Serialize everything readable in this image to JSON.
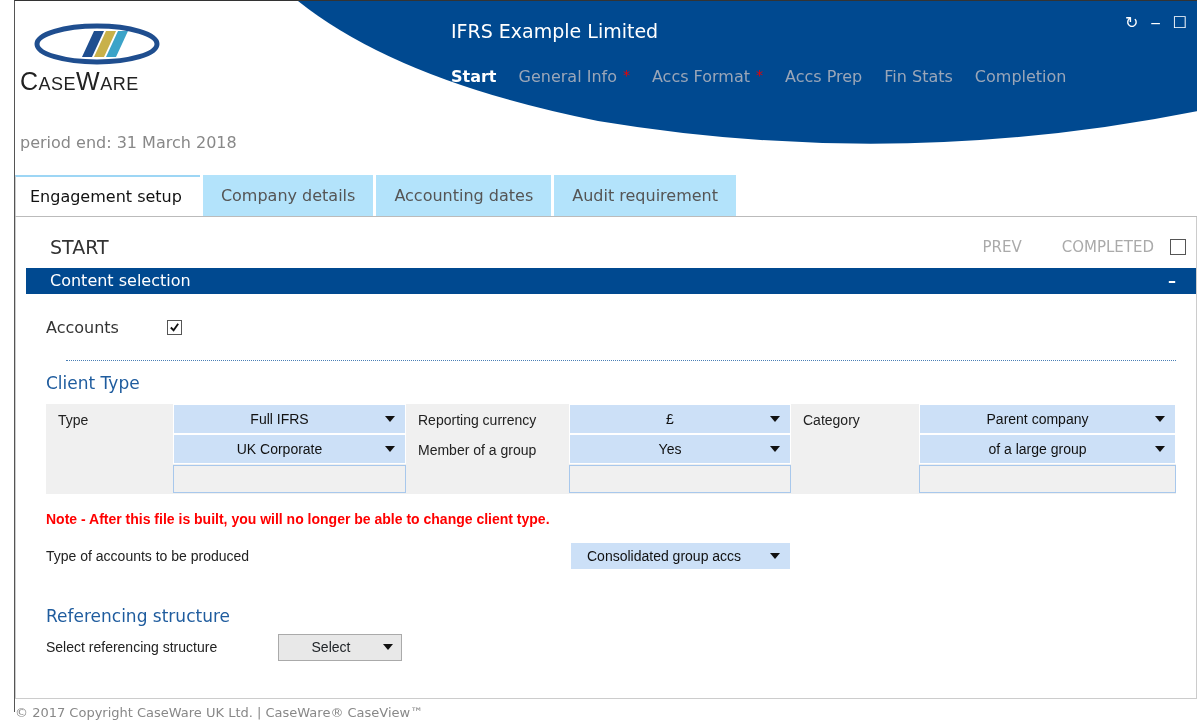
{
  "logo": {
    "wordmark": "CaseWare"
  },
  "header": {
    "title": "IFRS Example Limited"
  },
  "window_controls": [
    "↻",
    "‒",
    "☐"
  ],
  "nav": [
    {
      "label": "Start",
      "selected": true,
      "required": false
    },
    {
      "label": "General Info",
      "selected": false,
      "required": true
    },
    {
      "label": "Accs Format",
      "selected": false,
      "required": true
    },
    {
      "label": "Accs Prep",
      "selected": false,
      "required": false
    },
    {
      "label": "Fin Stats",
      "selected": false,
      "required": false
    },
    {
      "label": "Completion",
      "selected": false,
      "required": false
    }
  ],
  "required_mark": "*",
  "period_end": "period end: 31 March 2018",
  "tabs": [
    {
      "label": "Engagement setup",
      "selected": true
    },
    {
      "label": "Company details",
      "selected": false
    },
    {
      "label": "Accounting dates",
      "selected": false
    },
    {
      "label": "Audit requirement",
      "selected": false
    }
  ],
  "page_title": "START",
  "prev": "PREV",
  "completed": {
    "label": "COMPLETED",
    "checked": false
  },
  "section": {
    "title": "Content selection",
    "expanded": true,
    "toggle": "–"
  },
  "accounts": {
    "label": "Accounts",
    "checked": true
  },
  "client_type": {
    "heading": "Client Type",
    "groups": [
      {
        "label": "Type",
        "selects": [
          "Full IFRS",
          "UK Corporate"
        ]
      },
      {
        "label": "Reporting currency",
        "label_2": "Member of a group",
        "selects": [
          "£",
          "Yes"
        ]
      },
      {
        "label": "Category",
        "selects": [
          "Parent company",
          "of a large group"
        ]
      }
    ]
  },
  "note": "Note - After this file is built, you will no longer be able to change client type.",
  "accounts_type": {
    "label": "Type of accounts to be produced",
    "value": "Consolidated group accs"
  },
  "referencing": {
    "heading": "Referencing structure",
    "label": "Select referencing structure",
    "value": "Select"
  },
  "footer": "© 2017 Copyright CaseWare UK Ltd. | CaseWare® CaseView™"
}
